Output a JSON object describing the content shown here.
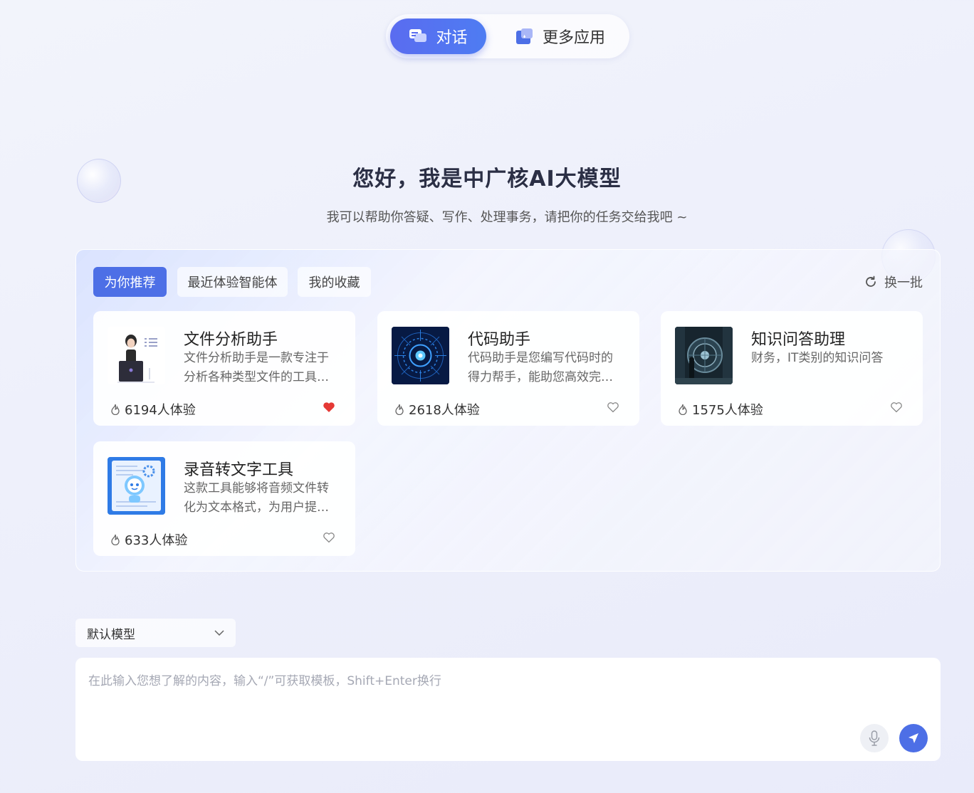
{
  "top_tabs": {
    "chat_label": "对话",
    "more_label": "更多应用"
  },
  "greeting": {
    "title": "您好，我是中广核AI大模型",
    "subtitle": "我可以帮助你答疑、写作、处理事务，请把你的任务交给我吧 ~"
  },
  "panel": {
    "tabs": [
      {
        "label": "为你推荐",
        "active": true
      },
      {
        "label": "最近体验智能体",
        "active": false
      },
      {
        "label": "我的收藏",
        "active": false
      }
    ],
    "refresh_label": "换一批",
    "cards": [
      {
        "title": "文件分析助手",
        "desc_line1": "文件分析助手是一款专注于",
        "desc_line2": "分析各种类型文件的工具…",
        "usage": "6194人体验",
        "favorited": true,
        "thumb_icon": "office-woman-laptop-illustration"
      },
      {
        "title": "代码助手",
        "desc_line1": "代码助手是您编写代码时的",
        "desc_line2": "得力帮手，能助您高效完…",
        "usage": "2618人体验",
        "favorited": false,
        "thumb_icon": "digital-circuit-target-image"
      },
      {
        "title": "知识问答助理",
        "desc_line1": "财务，IT类别的知识问答",
        "desc_line2": "",
        "usage": "1575人体验",
        "favorited": false,
        "thumb_icon": "vault-door-scene-image"
      },
      {
        "title": "录音转文字工具",
        "desc_line1": "这款工具能够将音频文件转",
        "desc_line2": "化为文本格式，为用户提…",
        "usage": "633人体验",
        "favorited": false,
        "thumb_icon": "robot-document-illustration"
      }
    ]
  },
  "model_select": {
    "value": "默认模型"
  },
  "composer": {
    "placeholder": "在此输入您想了解的内容，输入“/”可获取模板，Shift+Enter换行"
  },
  "colors": {
    "accent": "#4d6fe6",
    "heart_active": "#e53935"
  }
}
